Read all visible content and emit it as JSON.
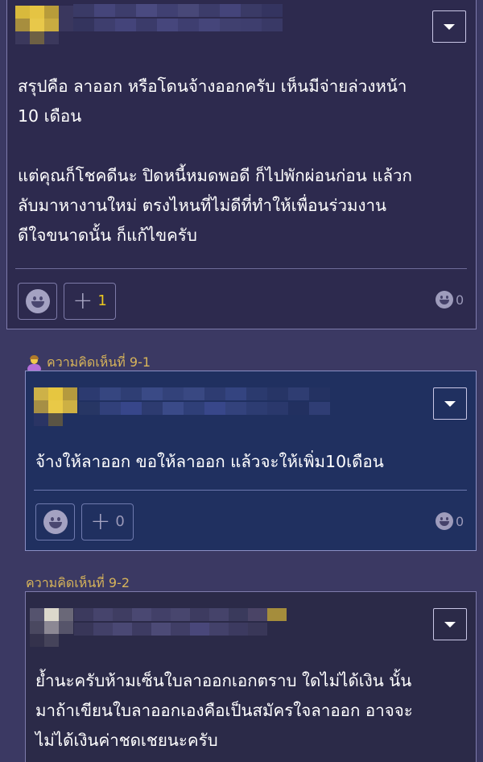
{
  "colors": {
    "page_bg": "#3b3963",
    "card_bg": "#2d2a4e",
    "reply_highlight_bg": "#203060",
    "reply_label": "#d7b45a",
    "plus_count_active": "#ecc81f"
  },
  "comment_main": {
    "avatar": "pixelated-avatar",
    "username": "",
    "body_lines": [
      "สรุปคือ ลาออก หรือโดนจ้างออกครับ เห็นมีจ่ายล่วงหน้า",
      "10 เดือน",
      "",
      "แต่คุณก็โชคดีนะ ปิดหนี้หมดพอดี ก็ไปพักผ่อนก่อน แล้วก",
      "ลับมาหางานใหม่ ตรงไหนที่ไม่ดีที่ทำให้เพื่อนร่วมงาน",
      "ดีใจขนาดนั้น ก็แก้ไขครับ"
    ],
    "plus_count": "1",
    "reaction_count": "0",
    "icons": {
      "menu": "chevron-down-icon",
      "emoji": "smiley-icon",
      "plus": "plus-icon"
    }
  },
  "reply_1": {
    "label": "ความคิดเห็นที่ 9-1",
    "label_icon": "person-icon",
    "body_lines": [
      "จ้างให้ลาออก ขอให้ลาออก แล้วจะให้เพิ่ม10เดือน"
    ],
    "plus_count": "0",
    "reaction_count": "0"
  },
  "reply_2": {
    "label": "ความคิดเห็นที่ 9-2",
    "body_lines": [
      "ย้ำนะครับห้ามเซ็นใบลาออกเอกตราบ ใดไม่ได้เงิน นั้น",
      "มาถ้าเขียนใบลาออกเองคือเป็นสมัครใจลาออก อาจจะ",
      "ไม่ได้เงินค่าชดเชยนะครับ"
    ]
  }
}
